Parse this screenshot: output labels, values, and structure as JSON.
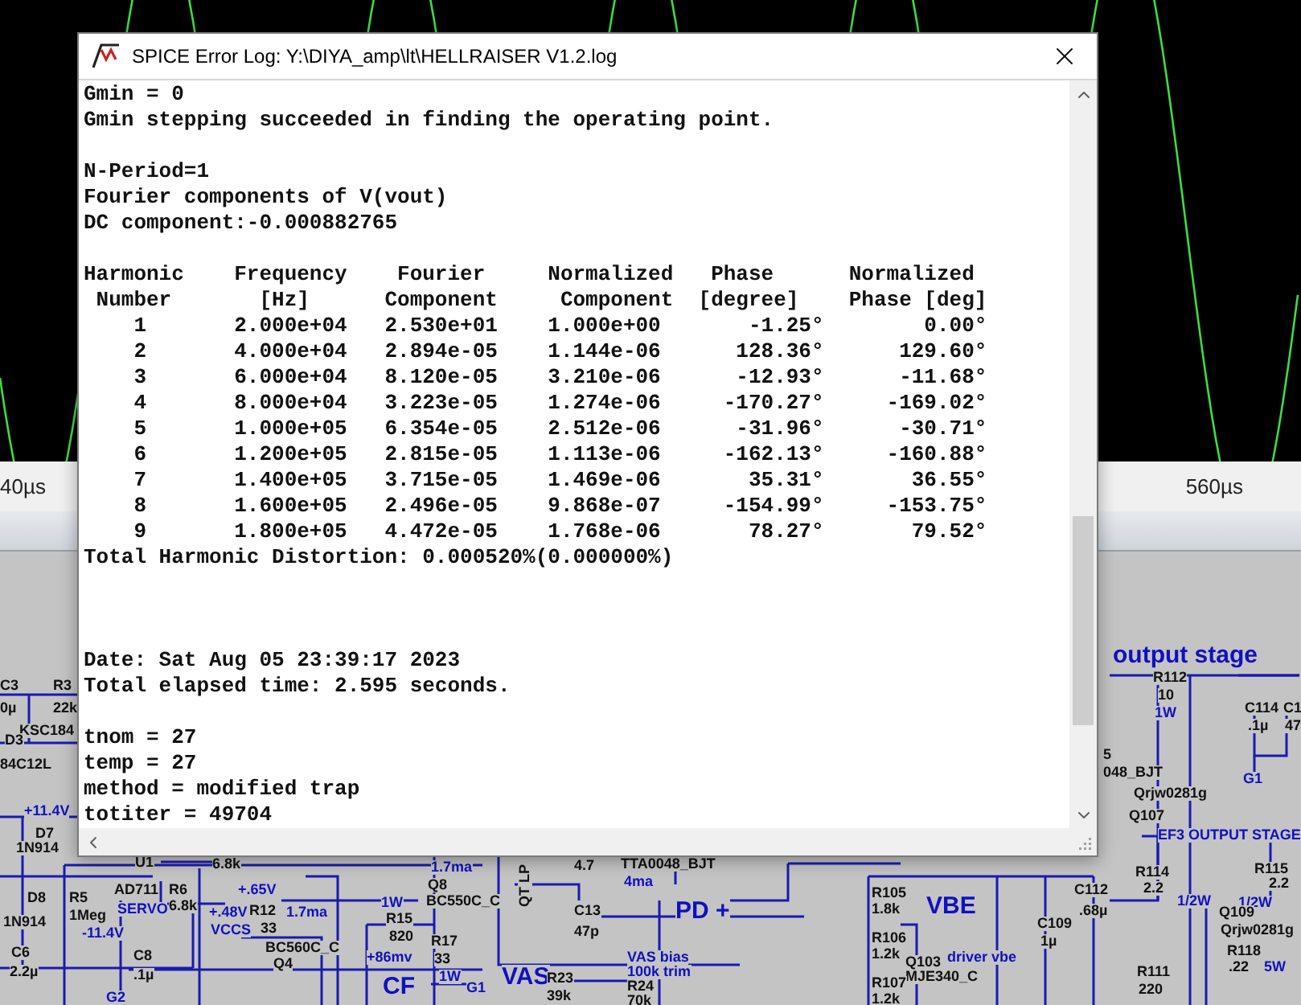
{
  "plot": {
    "x_axis_labels": [
      "40µs",
      "560µs"
    ]
  },
  "schematic": {
    "labels": [
      {
        "text": "C3",
        "kind": "part"
      },
      {
        "text": "0µ",
        "kind": "part"
      },
      {
        "text": "R3",
        "kind": "part"
      },
      {
        "text": "22k",
        "kind": "part"
      },
      {
        "text": "KSC184",
        "kind": "part"
      },
      {
        "text": "D3",
        "kind": "part"
      },
      {
        "text": "84C12L",
        "kind": "part"
      },
      {
        "text": "+11.4V",
        "kind": "note"
      },
      {
        "text": "D7",
        "kind": "part"
      },
      {
        "text": "1N914",
        "kind": "part"
      },
      {
        "text": "U1",
        "kind": "part"
      },
      {
        "text": "D8",
        "kind": "part"
      },
      {
        "text": "R5",
        "kind": "part"
      },
      {
        "text": "1Meg",
        "kind": "part"
      },
      {
        "text": "AD711",
        "kind": "part"
      },
      {
        "text": "SERVO",
        "kind": "note"
      },
      {
        "text": "R6",
        "kind": "part"
      },
      {
        "text": "6.8k",
        "kind": "part"
      },
      {
        "text": "6.8k",
        "kind": "part"
      },
      {
        "text": "-11.4V",
        "kind": "note"
      },
      {
        "text": "1N914",
        "kind": "part"
      },
      {
        "text": "C6",
        "kind": "part"
      },
      {
        "text": "2.2µ",
        "kind": "part"
      },
      {
        "text": "C8",
        "kind": "part"
      },
      {
        "text": ".1µ",
        "kind": "part"
      },
      {
        "text": "G2",
        "kind": "note"
      },
      {
        "text": "+.65V",
        "kind": "note"
      },
      {
        "text": "+.48V",
        "kind": "note"
      },
      {
        "text": "VCCS",
        "kind": "note"
      },
      {
        "text": "R12",
        "kind": "part"
      },
      {
        "text": "33",
        "kind": "part"
      },
      {
        "text": "1.7ma",
        "kind": "note"
      },
      {
        "text": "BC560C_C",
        "kind": "part"
      },
      {
        "text": "Q4",
        "kind": "part"
      },
      {
        "text": "1.7ma",
        "kind": "note"
      },
      {
        "text": "1W",
        "kind": "note"
      },
      {
        "text": "Q8",
        "kind": "part"
      },
      {
        "text": "BC550C_C",
        "kind": "part"
      },
      {
        "text": "R15",
        "kind": "part"
      },
      {
        "text": "820",
        "kind": "part"
      },
      {
        "text": "+86mv",
        "kind": "note"
      },
      {
        "text": "R17",
        "kind": "part"
      },
      {
        "text": "33",
        "kind": "part"
      },
      {
        "text": "1W",
        "kind": "note"
      },
      {
        "text": "CF",
        "kind": "heading"
      },
      {
        "text": "G1",
        "kind": "note"
      },
      {
        "text": "VAS",
        "kind": "heading"
      },
      {
        "text": "R23",
        "kind": "part"
      },
      {
        "text": "39k",
        "kind": "part"
      },
      {
        "text": "QT LP",
        "kind": "vertical"
      },
      {
        "text": "4.7",
        "kind": "part"
      },
      {
        "text": "TTA0048_BJT",
        "kind": "part"
      },
      {
        "text": "4ma",
        "kind": "note"
      },
      {
        "text": "C13",
        "kind": "part"
      },
      {
        "text": "47p",
        "kind": "part"
      },
      {
        "text": "PD +",
        "kind": "heading"
      },
      {
        "text": "VAS bias",
        "kind": "note"
      },
      {
        "text": "100k trim",
        "kind": "note"
      },
      {
        "text": "R24",
        "kind": "part"
      },
      {
        "text": "70k",
        "kind": "part"
      },
      {
        "text": "R105",
        "kind": "part"
      },
      {
        "text": "1.8k",
        "kind": "part"
      },
      {
        "text": "VBE",
        "kind": "heading"
      },
      {
        "text": "R106",
        "kind": "part"
      },
      {
        "text": "1.2k",
        "kind": "part"
      },
      {
        "text": "Q103",
        "kind": "part"
      },
      {
        "text": "MJE340_C",
        "kind": "part"
      },
      {
        "text": "driver vbe",
        "kind": "note"
      },
      {
        "text": "R107",
        "kind": "part"
      },
      {
        "text": "1.2k",
        "kind": "part"
      },
      {
        "text": "C109",
        "kind": "part"
      },
      {
        "text": "1µ",
        "kind": "part"
      },
      {
        "text": "C112",
        "kind": "part"
      },
      {
        "text": ".68µ",
        "kind": "part"
      },
      {
        "text": "output stage",
        "kind": "heading"
      },
      {
        "text": "R112",
        "kind": "part"
      },
      {
        "text": "10",
        "kind": "part"
      },
      {
        "text": "1W",
        "kind": "note"
      },
      {
        "text": "C114",
        "kind": "part"
      },
      {
        "text": ".1µ",
        "kind": "part"
      },
      {
        "text": "C1",
        "kind": "part"
      },
      {
        "text": "47",
        "kind": "part"
      },
      {
        "text": "G1",
        "kind": "note"
      },
      {
        "text": "5",
        "kind": "part"
      },
      {
        "text": "048_BJT",
        "kind": "part"
      },
      {
        "text": "Qrjw0281g",
        "kind": "part"
      },
      {
        "text": "Q107",
        "kind": "part"
      },
      {
        "text": "EF3 OUTPUT STAGE",
        "kind": "note"
      },
      {
        "text": "R114",
        "kind": "part"
      },
      {
        "text": "2.2",
        "kind": "part"
      },
      {
        "text": "1/2W",
        "kind": "note"
      },
      {
        "text": "R115",
        "kind": "part"
      },
      {
        "text": "2.2",
        "kind": "part"
      },
      {
        "text": "1/2W",
        "kind": "note"
      },
      {
        "text": "Q109",
        "kind": "part"
      },
      {
        "text": "Qrjw0281g",
        "kind": "part"
      },
      {
        "text": "R118",
        "kind": "part"
      },
      {
        "text": ".22",
        "kind": "part"
      },
      {
        "text": "5W",
        "kind": "note"
      },
      {
        "text": "R111",
        "kind": "part"
      },
      {
        "text": "220",
        "kind": "part"
      }
    ]
  },
  "log_window": {
    "title": "SPICE Error Log: Y:\\DIYA_amp\\lt\\HELLRAISER V1.2.log",
    "blocks": [
      {
        "lines": [
          "Gmin = 0",
          "Gmin stepping succeeded in finding the operating point."
        ]
      },
      {
        "lines": [
          "N-Period=1",
          "Fourier components of V(vout)",
          "DC component:-0.000882765"
        ]
      },
      {
        "lines": [
          "Harmonic    Frequency    Fourier     Normalized   Phase      Normalized",
          " Number       [Hz]      Component     Component  [degree]    Phase [deg]",
          "    1       2.000e+04   2.530e+01    1.000e+00       -1.25°        0.00°",
          "    2       4.000e+04   2.894e-05    1.144e-06      128.36°      129.60°",
          "    3       6.000e+04   8.120e-05    3.210e-06      -12.93°      -11.68°",
          "    4       8.000e+04   3.223e-05    1.274e-06     -170.27°     -169.02°",
          "    5       1.000e+05   6.354e-05    2.512e-06      -31.96°      -30.71°",
          "    6       1.200e+05   2.815e-05    1.113e-06     -162.13°     -160.88°",
          "    7       1.400e+05   3.715e-05    1.469e-06       35.31°       36.55°",
          "    8       1.600e+05   2.496e-05    9.868e-07     -154.99°     -153.75°",
          "    9       1.800e+05   4.472e-05    1.768e-06       78.27°       79.52°",
          "Total Harmonic Distortion: 0.000520%(0.000000%)"
        ]
      },
      {
        "lines": [
          "Date: Sat Aug 05 23:39:17 2023",
          "Total elapsed time: 2.595 seconds."
        ]
      },
      {
        "lines": [
          "tnom = 27",
          "temp = 27",
          "method = modified trap",
          "totiter = 49704"
        ]
      }
    ]
  }
}
